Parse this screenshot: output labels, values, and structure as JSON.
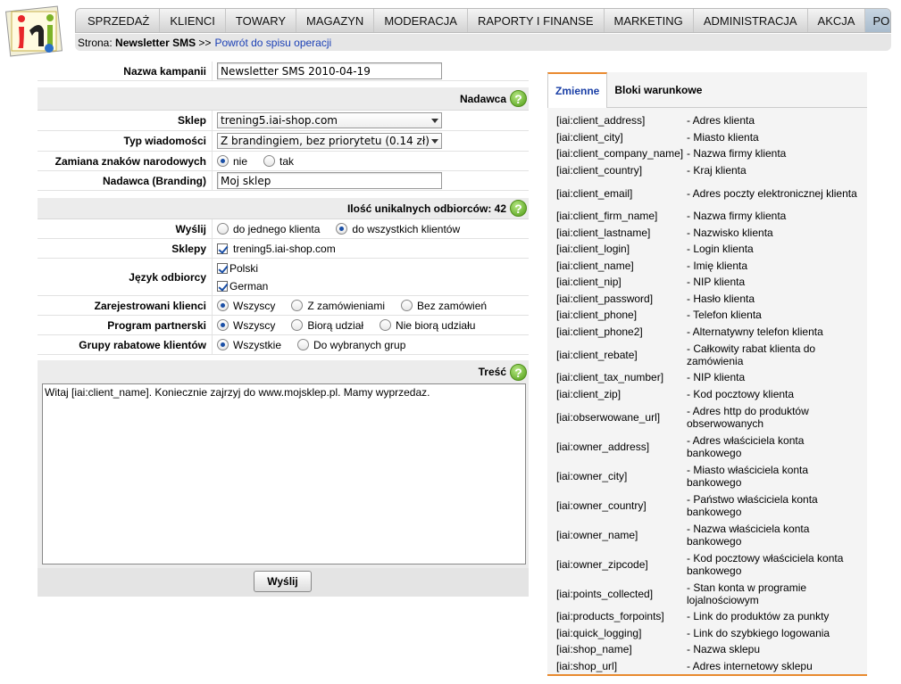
{
  "nav": {
    "items": [
      "SPRZEDAŻ",
      "KLIENCI",
      "TOWARY",
      "MAGAZYN",
      "MODERACJA",
      "RAPORTY I FINANSE",
      "MARKETING",
      "ADMINISTRACJA",
      "AKCJA"
    ],
    "help": "POMOC"
  },
  "breadcrumb": {
    "prefix": "Strona:",
    "current": "Newsletter SMS",
    "sep": ">>",
    "link": "Powrót do spisu operacji"
  },
  "form": {
    "campaign": {
      "label": "Nazwa kampanii",
      "value": "Newsletter SMS 2010-04-19"
    },
    "sender_section": "Nadawca",
    "shop": {
      "label": "Sklep",
      "value": "trening5.iai-shop.com"
    },
    "msg_type": {
      "label": "Typ wiadomości",
      "value": "Z brandingiem, bez priorytetu (0.14 zł)"
    },
    "national": {
      "label": "Zamiana znaków narodowych",
      "opt1": "nie",
      "opt2": "tak"
    },
    "branding": {
      "label": "Nadawca (Branding)",
      "value": "Moj sklep"
    },
    "recipients_section": "Ilość unikalnych odbiorców: 42",
    "send_to": {
      "label": "Wyślij",
      "opt1": "do jednego klienta",
      "opt2": "do wszystkich klientów"
    },
    "shops": {
      "label": "Sklepy",
      "item": "trening5.iai-shop.com"
    },
    "language": {
      "label": "Język odbiorcy",
      "opt1": "Polski",
      "opt2": "German"
    },
    "registered": {
      "label": "Zarejestrowani klienci",
      "opt1": "Wszyscy",
      "opt2": "Z zamówieniami",
      "opt3": "Bez zamówień"
    },
    "partner": {
      "label": "Program partnerski",
      "opt1": "Wszyscy",
      "opt2": "Biorą udział",
      "opt3": "Nie biorą udziału"
    },
    "discount": {
      "label": "Grupy rabatowe klientów",
      "opt1": "Wszystkie",
      "opt2": "Do wybranych grup"
    },
    "content_section": "Treść",
    "content": "Witaj [iai:client_name]. Koniecznie zajrzyj do www.mojsklep.pl. Mamy wyprzedaz.",
    "send_button": "Wyślij"
  },
  "panel": {
    "tabs": [
      "Zmienne",
      "Bloki warunkowe"
    ],
    "vars": [
      [
        "[iai:client_address]",
        "- Adres klienta"
      ],
      [
        "[iai:client_city]",
        "- Miasto klienta"
      ],
      [
        "[iai:client_company_name]",
        "- Nazwa firmy klienta"
      ],
      [
        "[iai:client_country]",
        "- Kraj klienta"
      ],
      [
        "[iai:client_email]",
        "- Adres poczty elektronicznej klienta"
      ],
      [
        "[iai:client_firm_name]",
        "- Nazwa firmy klienta"
      ],
      [
        "[iai:client_lastname]",
        "- Nazwisko klienta"
      ],
      [
        "[iai:client_login]",
        "- Login klienta"
      ],
      [
        "[iai:client_name]",
        "- Imię klienta"
      ],
      [
        "[iai:client_nip]",
        "- NIP klienta"
      ],
      [
        "[iai:client_password]",
        "- Hasło klienta"
      ],
      [
        "[iai:client_phone]",
        "- Telefon klienta"
      ],
      [
        "[iai:client_phone2]",
        "- Alternatywny telefon klienta"
      ],
      [
        "[iai:client_rebate]",
        "- Całkowity rabat klienta do zamówienia"
      ],
      [
        "[iai:client_tax_number]",
        "- NIP klienta"
      ],
      [
        "[iai:client_zip]",
        "- Kod pocztowy klienta"
      ],
      [
        "[iai:obserwowane_url]",
        "- Adres http do produktów obserwowanych"
      ],
      [
        "[iai:owner_address]",
        "- Adres właściciela konta bankowego"
      ],
      [
        "[iai:owner_city]",
        "- Miasto właściciela konta bankowego"
      ],
      [
        "[iai:owner_country]",
        "- Państwo właściciela konta bankowego"
      ],
      [
        "[iai:owner_name]",
        "- Nazwa właściciela konta bankowego"
      ],
      [
        "[iai:owner_zipcode]",
        "- Kod pocztowy właściciela konta bankowego"
      ],
      [
        "[iai:points_collected]",
        "- Stan konta w programie lojalnościowym"
      ],
      [
        "[iai:products_forpoints]",
        "- Link do produktów za punkty"
      ],
      [
        "[iai:quick_logging]",
        "- Link do szybkiego logowania"
      ],
      [
        "[iai:shop_name]",
        "- Nazwa sklepu"
      ],
      [
        "[iai:shop_url]",
        "- Adres internetowy sklepu"
      ]
    ]
  }
}
